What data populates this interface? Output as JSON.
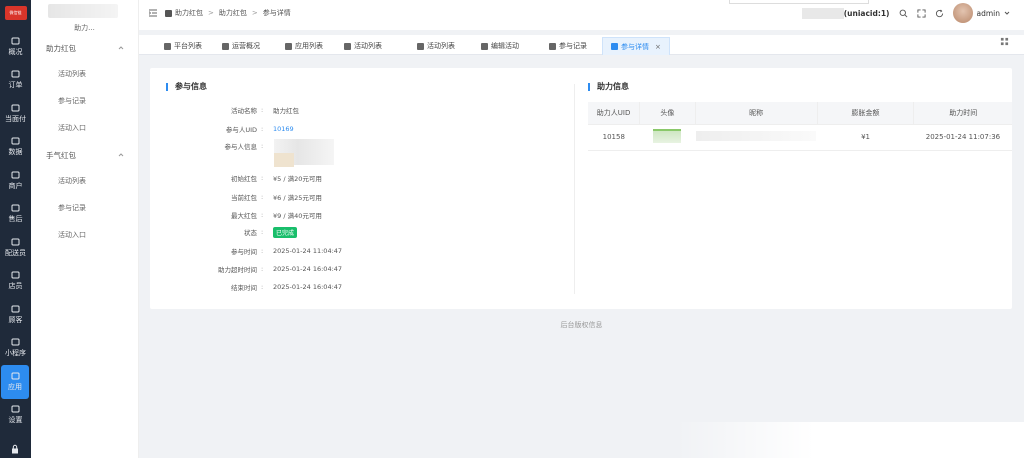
{
  "rail": {
    "logo_text": "微信链",
    "items": [
      "概况",
      "订单",
      "当面付",
      "数据",
      "商户",
      "售后",
      "配送员",
      "店员",
      "顾客",
      "小程序",
      "应用",
      "设置"
    ],
    "active_index": 10
  },
  "submenu": {
    "store_name": "助力...",
    "groups": [
      {
        "label": "助力红包",
        "items": [
          "活动列表",
          "参与记录",
          "活动入口"
        ]
      },
      {
        "label": "手气红包",
        "items": [
          "活动列表",
          "参与记录",
          "活动入口"
        ]
      }
    ]
  },
  "header": {
    "breadcrumb": [
      "助力红包",
      "助力红包",
      "参与详情"
    ],
    "uniacid": "(uniacid:1)",
    "user": "admin"
  },
  "tabs": [
    {
      "label": "平台列表"
    },
    {
      "label": "运营概况"
    },
    {
      "label": "应用列表"
    },
    {
      "label": "活动列表"
    },
    {
      "label": "活动列表"
    },
    {
      "label": "编辑活动"
    },
    {
      "label": "参与记录"
    },
    {
      "label": "参与详情",
      "active": true
    }
  ],
  "participation": {
    "title": "参与信息",
    "fields": [
      {
        "key": "活动名称",
        "value": "助力红包"
      },
      {
        "key": "参与人UID",
        "value": "10169",
        "link": true
      },
      {
        "key": "参与人信息",
        "value": ""
      },
      {
        "key": "初始红包",
        "value": "¥5 / 满20元可用"
      },
      {
        "key": "当前红包",
        "value": "¥6 / 满25元可用"
      },
      {
        "key": "最大红包",
        "value": "¥9 / 满40元可用"
      },
      {
        "key": "状态",
        "value": "已完成",
        "badge": true
      },
      {
        "key": "参与时间",
        "value": "2025-01-24 11:04:47"
      },
      {
        "key": "助力超时时间",
        "value": "2025-01-24 16:04:47"
      },
      {
        "key": "结束时间",
        "value": "2025-01-24 16:04:47"
      }
    ]
  },
  "help_info": {
    "title": "助力信息",
    "columns": [
      "助力人UID",
      "头像",
      "昵称",
      "膨胀金额",
      "助力时间"
    ],
    "rows": [
      {
        "uid": "10158",
        "amount": "¥1",
        "time": "2025-01-24 11:07:36"
      }
    ]
  },
  "footer": "后台版权信息"
}
